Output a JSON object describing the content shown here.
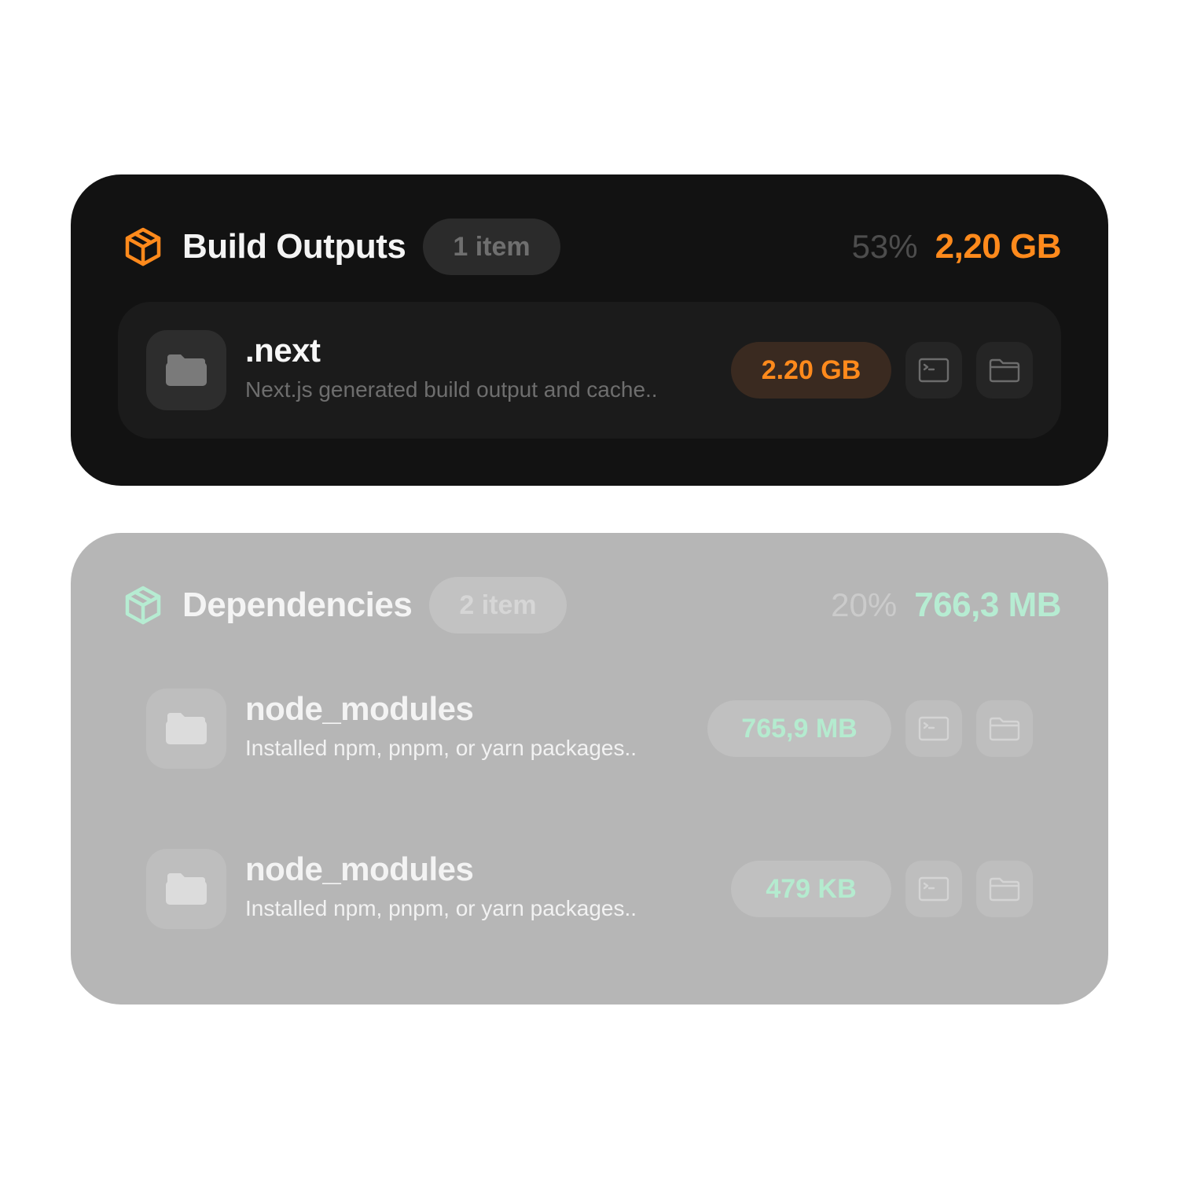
{
  "colors": {
    "build_accent": "#ff8a1c",
    "deps_accent": "#b6ecd2"
  },
  "build": {
    "icon": "cube-icon",
    "title": "Build Outputs",
    "count": "1 item",
    "percent": "53%",
    "total": "2,20 GB",
    "items": [
      {
        "icon": "folder-icon",
        "name": ".next",
        "description": "Next.js generated build output and cache..",
        "size": "2.20 GB",
        "actions": [
          "terminal-icon",
          "folder-open-icon"
        ]
      }
    ]
  },
  "deps": {
    "icon": "cube-icon",
    "title": "Dependencies",
    "count": "2 item",
    "percent": "20%",
    "total": "766,3 MB",
    "items": [
      {
        "icon": "folder-icon",
        "name": "node_modules",
        "description": "Installed npm, pnpm, or yarn packages..",
        "size": "765,9 MB",
        "actions": [
          "terminal-icon",
          "folder-open-icon"
        ]
      },
      {
        "icon": "folder-icon",
        "name": "node_modules",
        "description": "Installed npm, pnpm, or yarn packages..",
        "size": "479 KB",
        "actions": [
          "terminal-icon",
          "folder-open-icon"
        ]
      }
    ]
  }
}
